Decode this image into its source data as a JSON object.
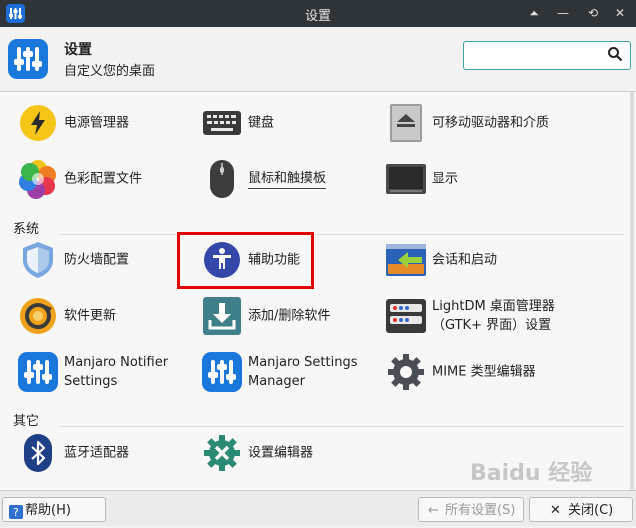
{
  "window": {
    "title": "设置",
    "controls": [
      "⏶",
      "—",
      "⟲",
      "✕"
    ]
  },
  "header": {
    "title": "设置",
    "subtitle": "自定义您的桌面"
  },
  "search": {
    "value": "",
    "placeholder": ""
  },
  "sections": {
    "hardware": {
      "items": [
        {
          "label": "电源管理器",
          "icon": "power-manager-icon"
        },
        {
          "label": "键盘",
          "icon": "keyboard-icon"
        },
        {
          "label": "可移动驱动器和介质",
          "icon": "removable-drive-icon"
        },
        {
          "label": "色彩配置文件",
          "icon": "color-profiles-icon"
        },
        {
          "label": "鼠标和触摸板",
          "icon": "mouse-icon"
        },
        {
          "label": "显示",
          "icon": "display-icon"
        }
      ]
    },
    "system": {
      "title": "系统",
      "items": [
        {
          "label": "防火墙配置",
          "icon": "firewall-icon"
        },
        {
          "label": "辅助功能",
          "icon": "accessibility-icon"
        },
        {
          "label": "会话和启动",
          "icon": "session-startup-icon"
        },
        {
          "label": "软件更新",
          "icon": "software-update-icon"
        },
        {
          "label": "添加/删除软件",
          "icon": "add-remove-software-icon"
        },
        {
          "label": "LightDM 桌面管理器\n（GTK+ 界面）设置",
          "icon": "lightdm-icon"
        },
        {
          "label": "Manjaro Notifier\nSettings",
          "icon": "manjaro-notifier-icon"
        },
        {
          "label": "Manjaro Settings\nManager",
          "icon": "manjaro-settings-icon"
        },
        {
          "label": "MIME 类型编辑器",
          "icon": "mime-editor-icon"
        }
      ]
    },
    "other": {
      "title": "其它",
      "items": [
        {
          "label": "蓝牙适配器",
          "icon": "bluetooth-icon"
        },
        {
          "label": "设置编辑器",
          "icon": "settings-editor-icon"
        }
      ]
    }
  },
  "footer": {
    "help": "帮助(H)",
    "all_settings": "所有设置(S)",
    "close": "关闭(C)"
  },
  "watermark": "Baidu 经验",
  "colors": {
    "accent": "#1a78dd",
    "highlight": "#e30000",
    "search_border": "#3aa2a0"
  }
}
